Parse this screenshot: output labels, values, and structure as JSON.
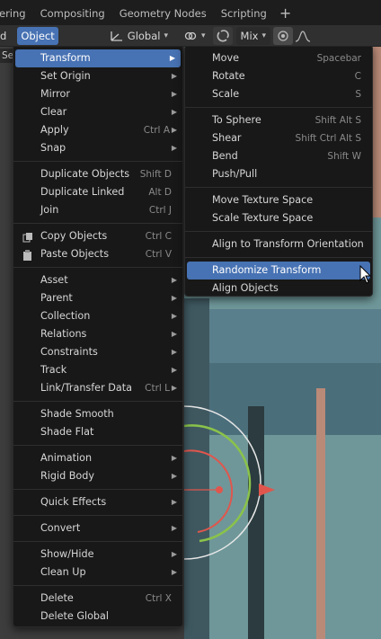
{
  "tabbar": {
    "tabs": [
      "ering",
      "Compositing",
      "Geometry Nodes",
      "Scripting"
    ],
    "add_label": "+"
  },
  "header": {
    "mode_partial": "d",
    "object_menu": "Object",
    "orientation": "Global",
    "blend_mode": "Mix",
    "select_partial": "Sel"
  },
  "object_menu": {
    "items": [
      {
        "label": "Transform",
        "shortcut": "",
        "submenu": true,
        "highlighted": true
      },
      {
        "label": "Set Origin",
        "shortcut": "",
        "submenu": true
      },
      {
        "label": "Mirror",
        "shortcut": "",
        "submenu": true
      },
      {
        "label": "Clear",
        "shortcut": "",
        "submenu": true
      },
      {
        "label": "Apply",
        "shortcut": "Ctrl A",
        "submenu": true
      },
      {
        "label": "Snap",
        "shortcut": "",
        "submenu": true
      },
      {
        "sep": true
      },
      {
        "label": "Duplicate Objects",
        "shortcut": "Shift D"
      },
      {
        "label": "Duplicate Linked",
        "shortcut": "Alt D"
      },
      {
        "label": "Join",
        "shortcut": "Ctrl J"
      },
      {
        "sep": true
      },
      {
        "label": "Copy Objects",
        "shortcut": "Ctrl C",
        "icon": "copy-icon"
      },
      {
        "label": "Paste Objects",
        "shortcut": "Ctrl V",
        "icon": "paste-icon"
      },
      {
        "sep": true
      },
      {
        "label": "Asset",
        "shortcut": "",
        "submenu": true
      },
      {
        "label": "Parent",
        "shortcut": "",
        "submenu": true
      },
      {
        "label": "Collection",
        "shortcut": "",
        "submenu": true
      },
      {
        "label": "Relations",
        "shortcut": "",
        "submenu": true
      },
      {
        "label": "Constraints",
        "shortcut": "",
        "submenu": true
      },
      {
        "label": "Track",
        "shortcut": "",
        "submenu": true
      },
      {
        "label": "Link/Transfer Data",
        "shortcut": "Ctrl L",
        "submenu": true
      },
      {
        "sep": true
      },
      {
        "label": "Shade Smooth",
        "shortcut": ""
      },
      {
        "label": "Shade Flat",
        "shortcut": ""
      },
      {
        "sep": true
      },
      {
        "label": "Animation",
        "shortcut": "",
        "submenu": true
      },
      {
        "label": "Rigid Body",
        "shortcut": "",
        "submenu": true
      },
      {
        "sep": true
      },
      {
        "label": "Quick Effects",
        "shortcut": "",
        "submenu": true
      },
      {
        "sep": true
      },
      {
        "label": "Convert",
        "shortcut": "",
        "submenu": true
      },
      {
        "sep": true
      },
      {
        "label": "Show/Hide",
        "shortcut": "",
        "submenu": true
      },
      {
        "label": "Clean Up",
        "shortcut": "",
        "submenu": true
      },
      {
        "sep": true
      },
      {
        "label": "Delete",
        "shortcut": "Ctrl X"
      },
      {
        "label": "Delete Global",
        "shortcut": ""
      }
    ]
  },
  "transform_menu": {
    "items": [
      {
        "label": "Move",
        "shortcut": "Spacebar"
      },
      {
        "label": "Rotate",
        "shortcut": "C"
      },
      {
        "label": "Scale",
        "shortcut": "S"
      },
      {
        "sep": true
      },
      {
        "label": "To Sphere",
        "shortcut": "Shift Alt S"
      },
      {
        "label": "Shear",
        "shortcut": "Shift Ctrl Alt S"
      },
      {
        "label": "Bend",
        "shortcut": "Shift W"
      },
      {
        "label": "Push/Pull",
        "shortcut": ""
      },
      {
        "sep": true
      },
      {
        "label": "Move Texture Space",
        "shortcut": ""
      },
      {
        "label": "Scale Texture Space",
        "shortcut": ""
      },
      {
        "sep": true
      },
      {
        "label": "Align to Transform Orientation",
        "shortcut": ""
      },
      {
        "sep": true
      },
      {
        "label": "Randomize Transform",
        "shortcut": "",
        "highlighted": true
      },
      {
        "label": "Align Objects",
        "shortcut": ""
      }
    ]
  },
  "colors": {
    "highlight": "#4772b3",
    "menu_bg": "#181818",
    "viewport": "#6f9799"
  }
}
